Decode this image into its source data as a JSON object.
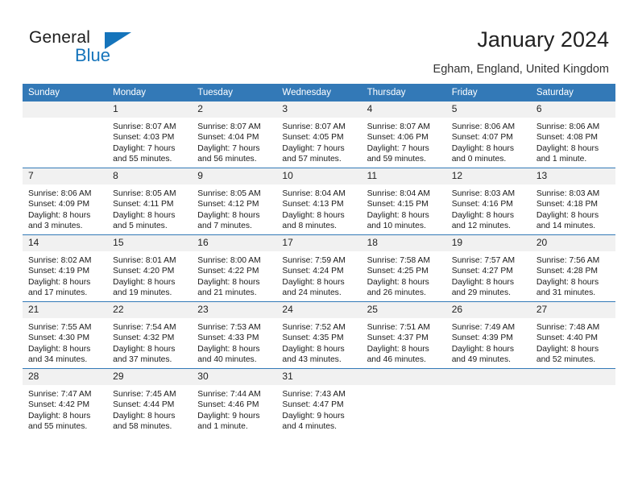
{
  "brand": {
    "name_part1": "General",
    "name_part2": "Blue",
    "triangle_color": "#1574bb"
  },
  "header": {
    "title": "January 2024",
    "subtitle": "Egham, England, United Kingdom"
  },
  "theme": {
    "header_blue": "#3379b7",
    "daynum_bg": "#f1f1f1",
    "text": "#222222"
  },
  "calendar": {
    "weekday_headers": [
      "Sunday",
      "Monday",
      "Tuesday",
      "Wednesday",
      "Thursday",
      "Friday",
      "Saturday"
    ],
    "weeks": [
      [
        {
          "day": "",
          "sunrise": "",
          "sunset": "",
          "daylight1": "",
          "daylight2": ""
        },
        {
          "day": "1",
          "sunrise": "Sunrise: 8:07 AM",
          "sunset": "Sunset: 4:03 PM",
          "daylight1": "Daylight: 7 hours",
          "daylight2": "and 55 minutes."
        },
        {
          "day": "2",
          "sunrise": "Sunrise: 8:07 AM",
          "sunset": "Sunset: 4:04 PM",
          "daylight1": "Daylight: 7 hours",
          "daylight2": "and 56 minutes."
        },
        {
          "day": "3",
          "sunrise": "Sunrise: 8:07 AM",
          "sunset": "Sunset: 4:05 PM",
          "daylight1": "Daylight: 7 hours",
          "daylight2": "and 57 minutes."
        },
        {
          "day": "4",
          "sunrise": "Sunrise: 8:07 AM",
          "sunset": "Sunset: 4:06 PM",
          "daylight1": "Daylight: 7 hours",
          "daylight2": "and 59 minutes."
        },
        {
          "day": "5",
          "sunrise": "Sunrise: 8:06 AM",
          "sunset": "Sunset: 4:07 PM",
          "daylight1": "Daylight: 8 hours",
          "daylight2": "and 0 minutes."
        },
        {
          "day": "6",
          "sunrise": "Sunrise: 8:06 AM",
          "sunset": "Sunset: 4:08 PM",
          "daylight1": "Daylight: 8 hours",
          "daylight2": "and 1 minute."
        }
      ],
      [
        {
          "day": "7",
          "sunrise": "Sunrise: 8:06 AM",
          "sunset": "Sunset: 4:09 PM",
          "daylight1": "Daylight: 8 hours",
          "daylight2": "and 3 minutes."
        },
        {
          "day": "8",
          "sunrise": "Sunrise: 8:05 AM",
          "sunset": "Sunset: 4:11 PM",
          "daylight1": "Daylight: 8 hours",
          "daylight2": "and 5 minutes."
        },
        {
          "day": "9",
          "sunrise": "Sunrise: 8:05 AM",
          "sunset": "Sunset: 4:12 PM",
          "daylight1": "Daylight: 8 hours",
          "daylight2": "and 7 minutes."
        },
        {
          "day": "10",
          "sunrise": "Sunrise: 8:04 AM",
          "sunset": "Sunset: 4:13 PM",
          "daylight1": "Daylight: 8 hours",
          "daylight2": "and 8 minutes."
        },
        {
          "day": "11",
          "sunrise": "Sunrise: 8:04 AM",
          "sunset": "Sunset: 4:15 PM",
          "daylight1": "Daylight: 8 hours",
          "daylight2": "and 10 minutes."
        },
        {
          "day": "12",
          "sunrise": "Sunrise: 8:03 AM",
          "sunset": "Sunset: 4:16 PM",
          "daylight1": "Daylight: 8 hours",
          "daylight2": "and 12 minutes."
        },
        {
          "day": "13",
          "sunrise": "Sunrise: 8:03 AM",
          "sunset": "Sunset: 4:18 PM",
          "daylight1": "Daylight: 8 hours",
          "daylight2": "and 14 minutes."
        }
      ],
      [
        {
          "day": "14",
          "sunrise": "Sunrise: 8:02 AM",
          "sunset": "Sunset: 4:19 PM",
          "daylight1": "Daylight: 8 hours",
          "daylight2": "and 17 minutes."
        },
        {
          "day": "15",
          "sunrise": "Sunrise: 8:01 AM",
          "sunset": "Sunset: 4:20 PM",
          "daylight1": "Daylight: 8 hours",
          "daylight2": "and 19 minutes."
        },
        {
          "day": "16",
          "sunrise": "Sunrise: 8:00 AM",
          "sunset": "Sunset: 4:22 PM",
          "daylight1": "Daylight: 8 hours",
          "daylight2": "and 21 minutes."
        },
        {
          "day": "17",
          "sunrise": "Sunrise: 7:59 AM",
          "sunset": "Sunset: 4:24 PM",
          "daylight1": "Daylight: 8 hours",
          "daylight2": "and 24 minutes."
        },
        {
          "day": "18",
          "sunrise": "Sunrise: 7:58 AM",
          "sunset": "Sunset: 4:25 PM",
          "daylight1": "Daylight: 8 hours",
          "daylight2": "and 26 minutes."
        },
        {
          "day": "19",
          "sunrise": "Sunrise: 7:57 AM",
          "sunset": "Sunset: 4:27 PM",
          "daylight1": "Daylight: 8 hours",
          "daylight2": "and 29 minutes."
        },
        {
          "day": "20",
          "sunrise": "Sunrise: 7:56 AM",
          "sunset": "Sunset: 4:28 PM",
          "daylight1": "Daylight: 8 hours",
          "daylight2": "and 31 minutes."
        }
      ],
      [
        {
          "day": "21",
          "sunrise": "Sunrise: 7:55 AM",
          "sunset": "Sunset: 4:30 PM",
          "daylight1": "Daylight: 8 hours",
          "daylight2": "and 34 minutes."
        },
        {
          "day": "22",
          "sunrise": "Sunrise: 7:54 AM",
          "sunset": "Sunset: 4:32 PM",
          "daylight1": "Daylight: 8 hours",
          "daylight2": "and 37 minutes."
        },
        {
          "day": "23",
          "sunrise": "Sunrise: 7:53 AM",
          "sunset": "Sunset: 4:33 PM",
          "daylight1": "Daylight: 8 hours",
          "daylight2": "and 40 minutes."
        },
        {
          "day": "24",
          "sunrise": "Sunrise: 7:52 AM",
          "sunset": "Sunset: 4:35 PM",
          "daylight1": "Daylight: 8 hours",
          "daylight2": "and 43 minutes."
        },
        {
          "day": "25",
          "sunrise": "Sunrise: 7:51 AM",
          "sunset": "Sunset: 4:37 PM",
          "daylight1": "Daylight: 8 hours",
          "daylight2": "and 46 minutes."
        },
        {
          "day": "26",
          "sunrise": "Sunrise: 7:49 AM",
          "sunset": "Sunset: 4:39 PM",
          "daylight1": "Daylight: 8 hours",
          "daylight2": "and 49 minutes."
        },
        {
          "day": "27",
          "sunrise": "Sunrise: 7:48 AM",
          "sunset": "Sunset: 4:40 PM",
          "daylight1": "Daylight: 8 hours",
          "daylight2": "and 52 minutes."
        }
      ],
      [
        {
          "day": "28",
          "sunrise": "Sunrise: 7:47 AM",
          "sunset": "Sunset: 4:42 PM",
          "daylight1": "Daylight: 8 hours",
          "daylight2": "and 55 minutes."
        },
        {
          "day": "29",
          "sunrise": "Sunrise: 7:45 AM",
          "sunset": "Sunset: 4:44 PM",
          "daylight1": "Daylight: 8 hours",
          "daylight2": "and 58 minutes."
        },
        {
          "day": "30",
          "sunrise": "Sunrise: 7:44 AM",
          "sunset": "Sunset: 4:46 PM",
          "daylight1": "Daylight: 9 hours",
          "daylight2": "and 1 minute."
        },
        {
          "day": "31",
          "sunrise": "Sunrise: 7:43 AM",
          "sunset": "Sunset: 4:47 PM",
          "daylight1": "Daylight: 9 hours",
          "daylight2": "and 4 minutes."
        },
        {
          "day": "",
          "sunrise": "",
          "sunset": "",
          "daylight1": "",
          "daylight2": ""
        },
        {
          "day": "",
          "sunrise": "",
          "sunset": "",
          "daylight1": "",
          "daylight2": ""
        },
        {
          "day": "",
          "sunrise": "",
          "sunset": "",
          "daylight1": "",
          "daylight2": ""
        }
      ]
    ]
  }
}
